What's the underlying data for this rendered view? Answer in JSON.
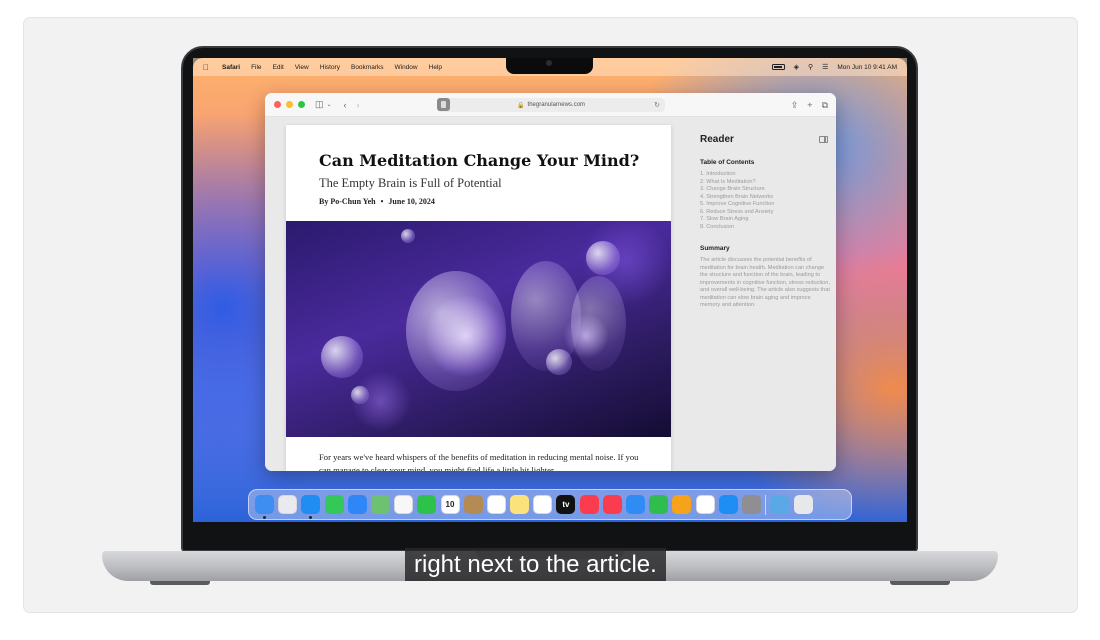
{
  "menubar": {
    "app": "Safari",
    "items": [
      "File",
      "Edit",
      "View",
      "History",
      "Bookmarks",
      "Window",
      "Help"
    ],
    "datetime": "Mon Jun 10  9:41 AM"
  },
  "safari": {
    "url": "thegranularnews.com"
  },
  "article": {
    "title": "Can Meditation Change Your Mind?",
    "subtitle": "The Empty Brain is Full of Potential",
    "author": "By Po-Chun Yeh",
    "date": "June 10, 2024",
    "body": "For years we've heard whispers of the benefits of meditation in reducing mental noise. If you can manage to clear your mind, you might find life a little bit lighter."
  },
  "reader": {
    "heading": "Reader",
    "toc_heading": "Table of Contents",
    "toc": [
      "1.  Introduction",
      "2.  What Is Meditation?",
      "3.  Change Brain Structure",
      "4.  Strengthen Brain Networks",
      "5.  Improve Cognitive Function",
      "6.  Reduce Stress and Anxiety",
      "7.  Slow Brain Aging",
      "8.  Conclusion"
    ],
    "summary_heading": "Summary",
    "summary": "The article discusses the potential benefits of meditation for brain health. Meditation can change the structure and function of the brain, leading to improvements in cognitive function, stress reduction, and overall well-being. The article also suggests that meditation can slow brain aging and improve memory and attention."
  },
  "dock": {
    "apps": [
      {
        "name": "finder-icon",
        "color": "#3d8ef0"
      },
      {
        "name": "launchpad-icon",
        "color": "#e9e9ef"
      },
      {
        "name": "safari-icon",
        "color": "#1f8df2"
      },
      {
        "name": "messages-icon",
        "color": "#34c759"
      },
      {
        "name": "mail-icon",
        "color": "#2f86f6"
      },
      {
        "name": "maps-icon",
        "color": "#6ec171"
      },
      {
        "name": "photos-icon",
        "color": "#f7f7f7"
      },
      {
        "name": "facetime-icon",
        "color": "#2fc24b"
      },
      {
        "name": "calendar-icon",
        "color": "#ffffff"
      },
      {
        "name": "contacts-icon",
        "color": "#b48a55"
      },
      {
        "name": "reminders-icon",
        "color": "#ffffff"
      },
      {
        "name": "notes-icon",
        "color": "#fbe27a"
      },
      {
        "name": "freeform-icon",
        "color": "#ffffff"
      },
      {
        "name": "tv-icon",
        "color": "#111111"
      },
      {
        "name": "music-icon",
        "color": "#fa3c4e"
      },
      {
        "name": "news-icon",
        "color": "#fa3c4e"
      },
      {
        "name": "keynote-icon",
        "color": "#2e8cf4"
      },
      {
        "name": "numbers-icon",
        "color": "#2ebd4e"
      },
      {
        "name": "pages-icon",
        "color": "#f7a21b"
      },
      {
        "name": "iphone-mirroring-icon",
        "color": "#ffffff"
      },
      {
        "name": "app-store-icon",
        "color": "#1e8ef5"
      },
      {
        "name": "system-settings-icon",
        "color": "#8e8e93"
      }
    ],
    "calendar_day": "10",
    "tv_label": "tv",
    "folders": [
      {
        "name": "downloads-folder-icon",
        "color": "#5aa9e6"
      },
      {
        "name": "trash-icon",
        "color": "#e6e8ec"
      }
    ]
  },
  "caption": "right next to the article."
}
